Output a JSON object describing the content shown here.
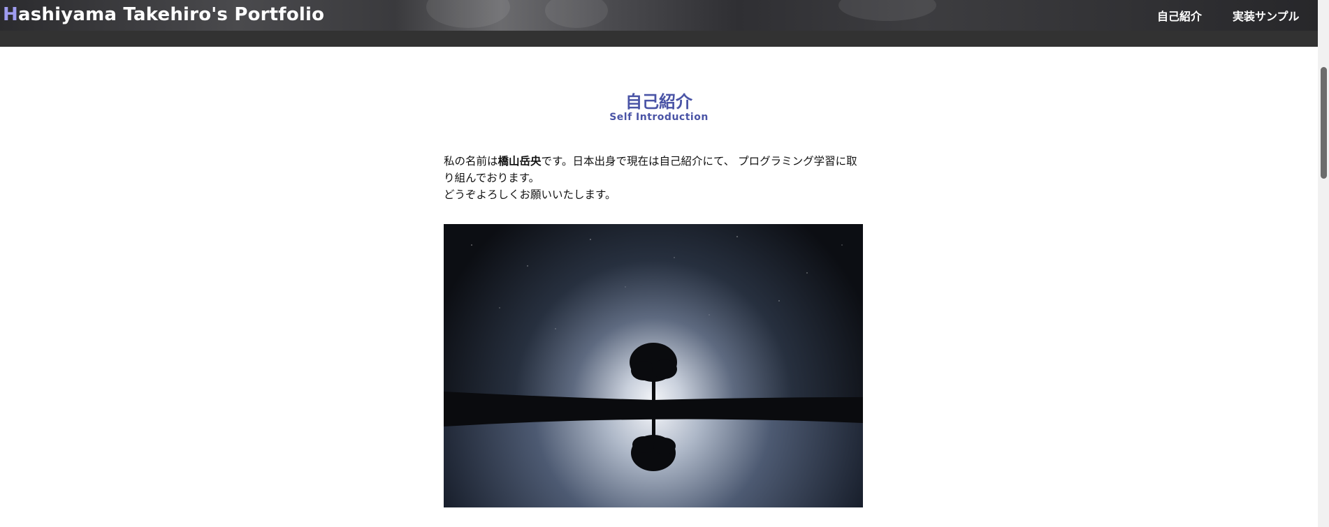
{
  "header": {
    "brand_initial": "H",
    "brand_rest": "ashiyama Takehiro's Portfolio",
    "nav": [
      {
        "label": "自己紹介"
      },
      {
        "label": "実装サンプル"
      }
    ]
  },
  "section": {
    "title_jp": "自己紹介",
    "title_en": "Self Introduction",
    "intro": {
      "before_name": "私の名前は",
      "name": "橋山岳央",
      "after_name": "です。日本出身で現在は自己紹介にて、 プログラミング学習に取り組んでおります。",
      "line2": "どうぞよろしくお願いいたします。"
    },
    "image_subject": "lone-tree-reflection-night-sky"
  },
  "colors": {
    "accent": "#4a54a6",
    "brand_initial": "#9f9cf0",
    "header_bg": "#323232"
  }
}
